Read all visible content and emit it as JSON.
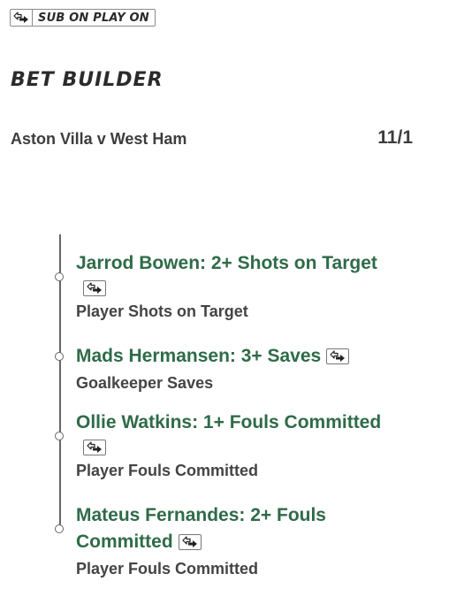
{
  "badge": {
    "label": "SUB ON PLAY ON",
    "icon": "swap-arrows-icon"
  },
  "header": {
    "title": "BET BUILDER"
  },
  "match": {
    "name": "Aston Villa v West Ham",
    "odds": "11/1"
  },
  "legs": [
    {
      "selection": "Jarrod Bowen: 2+ Shots on Target",
      "market": "Player Shots on Target",
      "has_sub_icon": true
    },
    {
      "selection": "Mads Hermansen: 3+ Saves",
      "market": "Goalkeeper Saves",
      "has_sub_icon": true
    },
    {
      "selection": "Ollie Watkins: 1+ Fouls Committed",
      "market": "Player Fouls Committed",
      "has_sub_icon": true
    },
    {
      "selection_line1": "Mateus Fernandes: 2+ Fouls",
      "selection_line2": "Committed",
      "market": "Player Fouls Committed",
      "has_sub_icon": true
    }
  ],
  "colors": {
    "selection_green": "#2f6b48",
    "text_dark": "#3d3d3d"
  }
}
